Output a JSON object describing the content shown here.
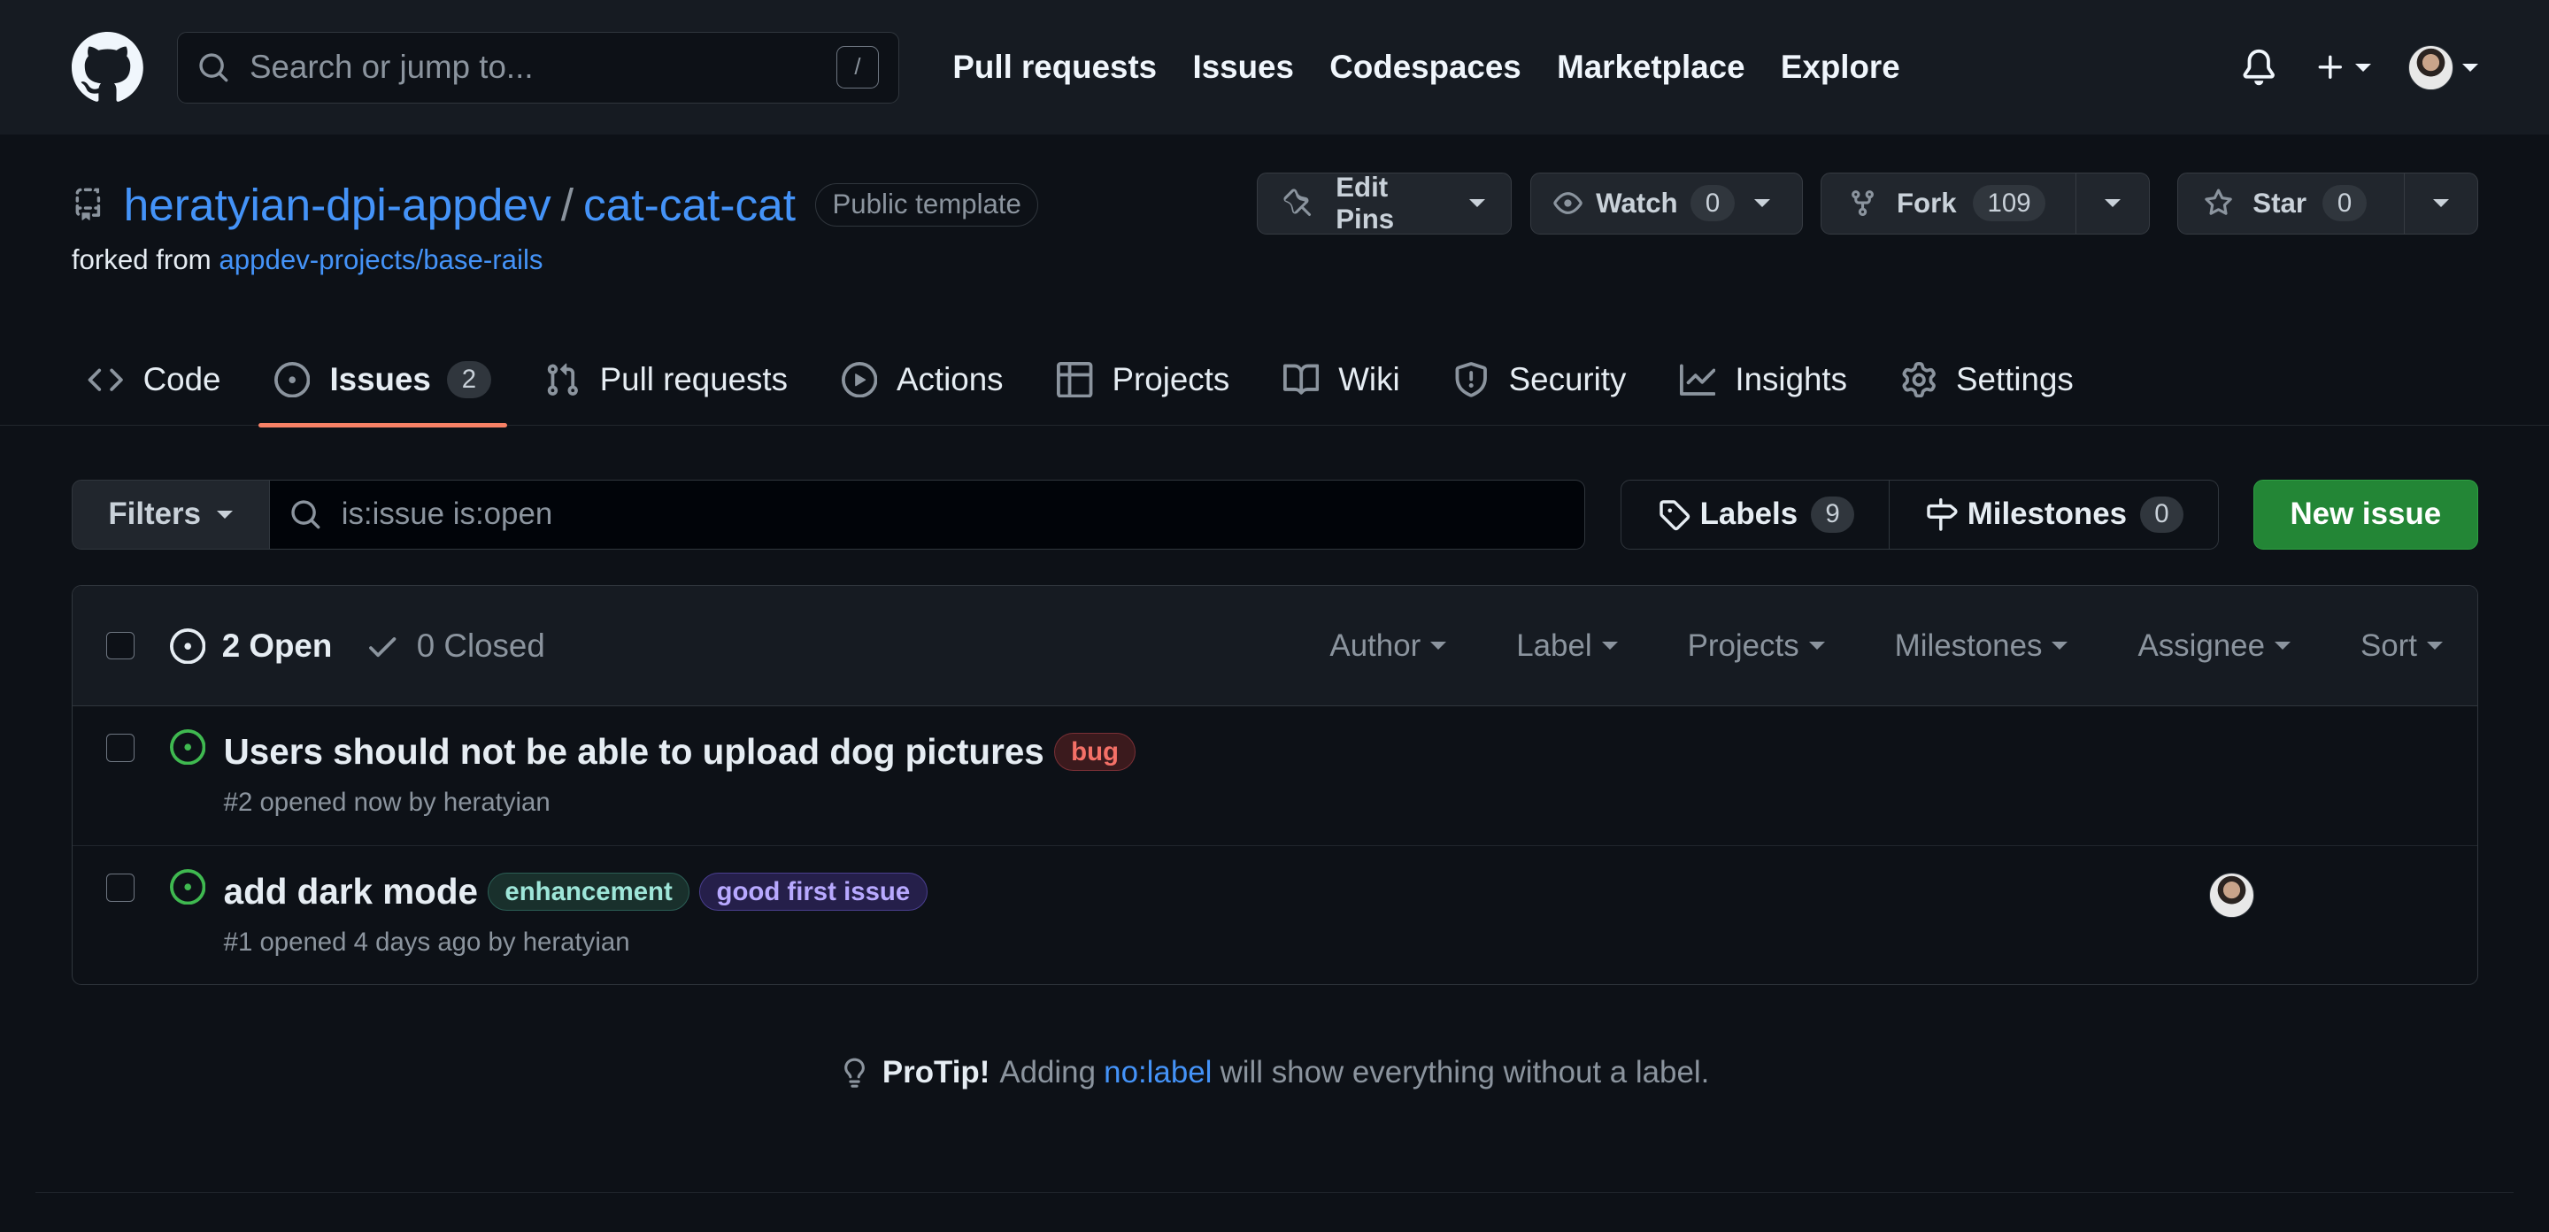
{
  "header": {
    "search_placeholder": "Search or jump to...",
    "search_shortcut": "/",
    "nav": [
      "Pull requests",
      "Issues",
      "Codespaces",
      "Marketplace",
      "Explore"
    ]
  },
  "repo": {
    "owner": "heratyian-dpi-appdev",
    "separator": "/",
    "name": "cat-cat-cat",
    "visibility": "Public template",
    "forked_prefix": "forked from",
    "forked_from": "appdev-projects/base-rails",
    "actions": {
      "edit_pins": "Edit Pins",
      "watch": "Watch",
      "watch_count": "0",
      "fork": "Fork",
      "fork_count": "109",
      "star": "Star",
      "star_count": "0"
    }
  },
  "tabs": [
    {
      "label": "Code",
      "icon": "code-icon"
    },
    {
      "label": "Issues",
      "icon": "issue-opened-icon",
      "count": "2",
      "active": true
    },
    {
      "label": "Pull requests",
      "icon": "git-pull-request-icon"
    },
    {
      "label": "Actions",
      "icon": "play-icon"
    },
    {
      "label": "Projects",
      "icon": "table-icon"
    },
    {
      "label": "Wiki",
      "icon": "book-icon"
    },
    {
      "label": "Security",
      "icon": "shield-icon"
    },
    {
      "label": "Insights",
      "icon": "graph-icon"
    },
    {
      "label": "Settings",
      "icon": "gear-icon"
    }
  ],
  "filterbar": {
    "filters_label": "Filters",
    "query": "is:issue is:open",
    "labels_label": "Labels",
    "labels_count": "9",
    "milestones_label": "Milestones",
    "milestones_count": "0",
    "new_issue_label": "New issue"
  },
  "list_header": {
    "open_label": "2 Open",
    "closed_label": "0 Closed",
    "filters": [
      "Author",
      "Label",
      "Projects",
      "Milestones",
      "Assignee",
      "Sort"
    ]
  },
  "issues": [
    {
      "title": "Users should not be able to upload dog pictures",
      "labels": [
        {
          "name": "bug",
          "bg": "#3b1a1d",
          "fg": "#f47067",
          "border": "#7a3036"
        }
      ],
      "meta": "#2 opened now by heratyian",
      "has_assignee": false
    },
    {
      "title": "add dark mode",
      "labels": [
        {
          "name": "enhancement",
          "bg": "#19302c",
          "fg": "#9ee6d9",
          "border": "#2b5e55"
        },
        {
          "name": "good first issue",
          "bg": "#251f4a",
          "fg": "#b8a9ff",
          "border": "#4a3f8f"
        }
      ],
      "meta": "#1 opened 4 days ago by heratyian",
      "has_assignee": true
    }
  ],
  "protip": {
    "title": "ProTip!",
    "before": "Adding",
    "link": "no:label",
    "after": "will show everything without a label."
  },
  "colors": {
    "accent": "#4493f8",
    "tab_underline": "#f78166",
    "new_issue_bg": "#238636",
    "open_icon": "#3fb950"
  }
}
